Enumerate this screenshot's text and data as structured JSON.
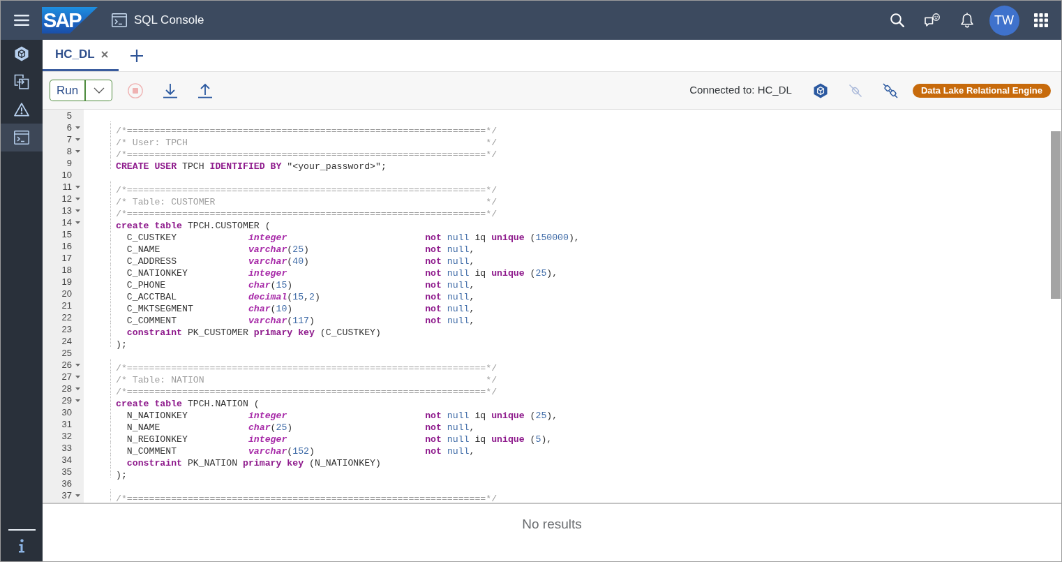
{
  "header": {
    "logo": "SAP",
    "title": "SQL Console",
    "avatar": "TW"
  },
  "sidebar": {
    "items": [
      {
        "selected": false
      },
      {
        "selected": false
      },
      {
        "selected": false
      },
      {
        "selected": true
      }
    ]
  },
  "tabs": [
    {
      "label": "HC_DL",
      "selected": true,
      "closable": true
    }
  ],
  "toolbar": {
    "run_button": "Run",
    "actions": [
      {
        "disabled": true
      },
      {
        "disabled": false
      },
      {
        "disabled": false
      }
    ],
    "connection": "Connected to: HC_DL",
    "connection_actions": [
      {
        "disabled": false
      },
      {
        "disabled": true
      },
      {
        "disabled": false
      }
    ],
    "engine_badge": "Data Lake Relational Engine"
  },
  "editor": {
    "lines": [
      {
        "number": "5",
        "foldable": false
      },
      {
        "number": "6",
        "foldable": true,
        "tokens": [
          {
            "kind": "comment",
            "text": "/*=================================================================*/"
          }
        ]
      },
      {
        "number": "7",
        "foldable": true,
        "tokens": [
          {
            "kind": "comment",
            "text": "/* User: TPCH                                                      */"
          }
        ]
      },
      {
        "number": "8",
        "foldable": true,
        "tokens": [
          {
            "kind": "comment",
            "text": "/*=================================================================*/"
          }
        ]
      },
      {
        "number": "9",
        "foldable": false,
        "tokens": [
          {
            "kind": "keyword",
            "text": "CREATE USER"
          },
          {
            "kind": "plain",
            "text": " TPCH "
          },
          {
            "kind": "keyword",
            "text": "IDENTIFIED BY"
          },
          {
            "kind": "plain",
            "text": " \"<your_password>\";"
          }
        ]
      },
      {
        "number": "10",
        "foldable": false
      },
      {
        "number": "11",
        "foldable": true,
        "tokens": [
          {
            "kind": "comment",
            "text": "/*=================================================================*/"
          }
        ]
      },
      {
        "number": "12",
        "foldable": true,
        "tokens": [
          {
            "kind": "comment",
            "text": "/* Table: CUSTOMER                                                 */"
          }
        ]
      },
      {
        "number": "13",
        "foldable": true,
        "tokens": [
          {
            "kind": "comment",
            "text": "/*=================================================================*/"
          }
        ]
      },
      {
        "number": "14",
        "foldable": true,
        "tokens": [
          {
            "kind": "keyword",
            "text": "create table"
          },
          {
            "kind": "plain",
            "text": " TPCH.CUSTOMER ("
          }
        ]
      },
      {
        "number": "15",
        "foldable": false,
        "tokens": [
          {
            "kind": "plain",
            "text": "  C_CUSTKEY             "
          },
          {
            "kind": "type",
            "text": "integer                         "
          },
          {
            "kind": "keyword",
            "text": "not "
          },
          {
            "kind": "literal",
            "text": "null"
          },
          {
            "kind": "plain",
            "text": " iq "
          },
          {
            "kind": "keyword",
            "text": "unique"
          },
          {
            "kind": "plain",
            "text": " ("
          },
          {
            "kind": "number",
            "text": "150000"
          },
          {
            "kind": "plain",
            "text": "),"
          }
        ]
      },
      {
        "number": "16",
        "foldable": false,
        "tokens": [
          {
            "kind": "plain",
            "text": "  C_NAME                "
          },
          {
            "kind": "type",
            "text": "varchar"
          },
          {
            "kind": "plain",
            "text": "("
          },
          {
            "kind": "number",
            "text": "25"
          },
          {
            "kind": "plain",
            "text": ")                     "
          },
          {
            "kind": "keyword",
            "text": "not "
          },
          {
            "kind": "literal",
            "text": "null"
          },
          {
            "kind": "plain",
            "text": ","
          }
        ]
      },
      {
        "number": "17",
        "foldable": false,
        "tokens": [
          {
            "kind": "plain",
            "text": "  C_ADDRESS             "
          },
          {
            "kind": "type",
            "text": "varchar"
          },
          {
            "kind": "plain",
            "text": "("
          },
          {
            "kind": "number",
            "text": "40"
          },
          {
            "kind": "plain",
            "text": ")                     "
          },
          {
            "kind": "keyword",
            "text": "not "
          },
          {
            "kind": "literal",
            "text": "null"
          },
          {
            "kind": "plain",
            "text": ","
          }
        ]
      },
      {
        "number": "18",
        "foldable": false,
        "tokens": [
          {
            "kind": "plain",
            "text": "  C_NATIONKEY           "
          },
          {
            "kind": "type",
            "text": "integer                         "
          },
          {
            "kind": "keyword",
            "text": "not "
          },
          {
            "kind": "literal",
            "text": "null"
          },
          {
            "kind": "plain",
            "text": " iq "
          },
          {
            "kind": "keyword",
            "text": "unique"
          },
          {
            "kind": "plain",
            "text": " ("
          },
          {
            "kind": "number",
            "text": "25"
          },
          {
            "kind": "plain",
            "text": "),"
          }
        ]
      },
      {
        "number": "19",
        "foldable": false,
        "tokens": [
          {
            "kind": "plain",
            "text": "  C_PHONE               "
          },
          {
            "kind": "type",
            "text": "char"
          },
          {
            "kind": "plain",
            "text": "("
          },
          {
            "kind": "number",
            "text": "15"
          },
          {
            "kind": "plain",
            "text": ")                        "
          },
          {
            "kind": "keyword",
            "text": "not "
          },
          {
            "kind": "literal",
            "text": "null"
          },
          {
            "kind": "plain",
            "text": ","
          }
        ]
      },
      {
        "number": "20",
        "foldable": false,
        "tokens": [
          {
            "kind": "plain",
            "text": "  C_ACCTBAL             "
          },
          {
            "kind": "type",
            "text": "decimal"
          },
          {
            "kind": "plain",
            "text": "("
          },
          {
            "kind": "number",
            "text": "15"
          },
          {
            "kind": "plain",
            "text": ","
          },
          {
            "kind": "number",
            "text": "2"
          },
          {
            "kind": "plain",
            "text": ")                   "
          },
          {
            "kind": "keyword",
            "text": "not "
          },
          {
            "kind": "literal",
            "text": "null"
          },
          {
            "kind": "plain",
            "text": ","
          }
        ]
      },
      {
        "number": "21",
        "foldable": false,
        "tokens": [
          {
            "kind": "plain",
            "text": "  C_MKTSEGMENT          "
          },
          {
            "kind": "type",
            "text": "char"
          },
          {
            "kind": "plain",
            "text": "("
          },
          {
            "kind": "number",
            "text": "10"
          },
          {
            "kind": "plain",
            "text": ")                        "
          },
          {
            "kind": "keyword",
            "text": "not "
          },
          {
            "kind": "literal",
            "text": "null"
          },
          {
            "kind": "plain",
            "text": ","
          }
        ]
      },
      {
        "number": "22",
        "foldable": false,
        "tokens": [
          {
            "kind": "plain",
            "text": "  C_COMMENT             "
          },
          {
            "kind": "type",
            "text": "varchar"
          },
          {
            "kind": "plain",
            "text": "("
          },
          {
            "kind": "number",
            "text": "117"
          },
          {
            "kind": "plain",
            "text": ")                    "
          },
          {
            "kind": "keyword",
            "text": "not "
          },
          {
            "kind": "literal",
            "text": "null"
          },
          {
            "kind": "plain",
            "text": ","
          }
        ]
      },
      {
        "number": "23",
        "foldable": false,
        "tokens": [
          {
            "kind": "keyword",
            "text": "  constraint"
          },
          {
            "kind": "plain",
            "text": " PK_CUSTOMER "
          },
          {
            "kind": "keyword",
            "text": "primary key"
          },
          {
            "kind": "plain",
            "text": " (C_CUSTKEY)"
          }
        ]
      },
      {
        "number": "24",
        "foldable": false,
        "tokens": [
          {
            "kind": "plain",
            "text": ");"
          }
        ]
      },
      {
        "number": "25",
        "foldable": false
      },
      {
        "number": "26",
        "foldable": true,
        "tokens": [
          {
            "kind": "comment",
            "text": "/*=================================================================*/"
          }
        ]
      },
      {
        "number": "27",
        "foldable": true,
        "tokens": [
          {
            "kind": "comment",
            "text": "/* Table: NATION                                                   */"
          }
        ]
      },
      {
        "number": "28",
        "foldable": true,
        "tokens": [
          {
            "kind": "comment",
            "text": "/*=================================================================*/"
          }
        ]
      },
      {
        "number": "29",
        "foldable": true,
        "tokens": [
          {
            "kind": "keyword",
            "text": "create table"
          },
          {
            "kind": "plain",
            "text": " TPCH.NATION ("
          }
        ]
      },
      {
        "number": "30",
        "foldable": false,
        "tokens": [
          {
            "kind": "plain",
            "text": "  N_NATIONKEY           "
          },
          {
            "kind": "type",
            "text": "integer                         "
          },
          {
            "kind": "keyword",
            "text": "not "
          },
          {
            "kind": "literal",
            "text": "null"
          },
          {
            "kind": "plain",
            "text": " iq "
          },
          {
            "kind": "keyword",
            "text": "unique"
          },
          {
            "kind": "plain",
            "text": " ("
          },
          {
            "kind": "number",
            "text": "25"
          },
          {
            "kind": "plain",
            "text": "),"
          }
        ]
      },
      {
        "number": "31",
        "foldable": false,
        "tokens": [
          {
            "kind": "plain",
            "text": "  N_NAME                "
          },
          {
            "kind": "type",
            "text": "char"
          },
          {
            "kind": "plain",
            "text": "("
          },
          {
            "kind": "number",
            "text": "25"
          },
          {
            "kind": "plain",
            "text": ")                        "
          },
          {
            "kind": "keyword",
            "text": "not "
          },
          {
            "kind": "literal",
            "text": "null"
          },
          {
            "kind": "plain",
            "text": ","
          }
        ]
      },
      {
        "number": "32",
        "foldable": false,
        "tokens": [
          {
            "kind": "plain",
            "text": "  N_REGIONKEY           "
          },
          {
            "kind": "type",
            "text": "integer                         "
          },
          {
            "kind": "keyword",
            "text": "not "
          },
          {
            "kind": "literal",
            "text": "null"
          },
          {
            "kind": "plain",
            "text": " iq "
          },
          {
            "kind": "keyword",
            "text": "unique"
          },
          {
            "kind": "plain",
            "text": " ("
          },
          {
            "kind": "number",
            "text": "5"
          },
          {
            "kind": "plain",
            "text": "),"
          }
        ]
      },
      {
        "number": "33",
        "foldable": false,
        "tokens": [
          {
            "kind": "plain",
            "text": "  N_COMMENT             "
          },
          {
            "kind": "type",
            "text": "varchar"
          },
          {
            "kind": "plain",
            "text": "("
          },
          {
            "kind": "number",
            "text": "152"
          },
          {
            "kind": "plain",
            "text": ")                    "
          },
          {
            "kind": "keyword",
            "text": "not "
          },
          {
            "kind": "literal",
            "text": "null"
          },
          {
            "kind": "plain",
            "text": ","
          }
        ]
      },
      {
        "number": "34",
        "foldable": false,
        "tokens": [
          {
            "kind": "keyword",
            "text": "  constraint"
          },
          {
            "kind": "plain",
            "text": " PK_NATION "
          },
          {
            "kind": "keyword",
            "text": "primary key"
          },
          {
            "kind": "plain",
            "text": " (N_NATIONKEY)"
          }
        ]
      },
      {
        "number": "35",
        "foldable": false,
        "tokens": [
          {
            "kind": "plain",
            "text": ");"
          }
        ]
      },
      {
        "number": "36",
        "foldable": false
      },
      {
        "number": "37",
        "foldable": true,
        "tokens": [
          {
            "kind": "comment",
            "text": "/*=================================================================*/"
          }
        ]
      }
    ]
  },
  "results": {
    "message": "No results"
  }
}
